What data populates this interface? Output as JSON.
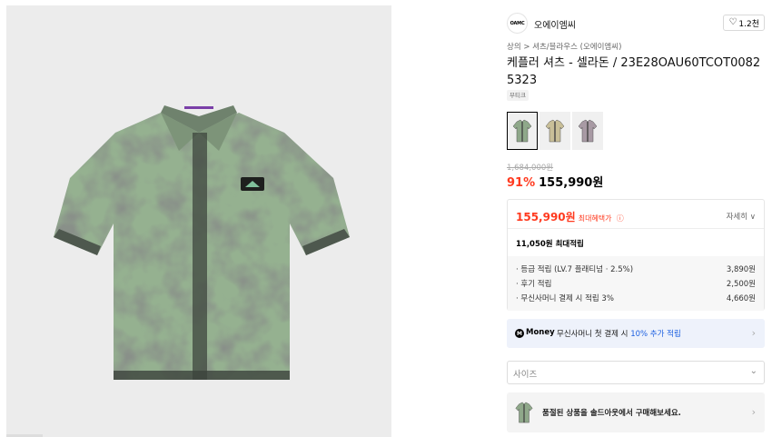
{
  "brand": {
    "logo_text": "OAMC",
    "name": "오에이엠씨",
    "likes": "1.2천"
  },
  "breadcrumb": "상의 > 셔츠/블라우스 (오에이엠씨)",
  "product": {
    "title": "케플러 셔츠 - 셀라돈 / 23E28OAU60TCOT00825323",
    "badge": "부티크",
    "original_price": "1,684,000원",
    "discount": "91%",
    "price": "155,990원"
  },
  "swatches": [
    {
      "color": "#8fa88a",
      "active": true
    },
    {
      "color": "#c9bf98",
      "active": false
    },
    {
      "color": "#a89aa4",
      "active": false
    }
  ],
  "benefits": {
    "price": "155,990원",
    "max_label": "최대혜택가",
    "info_icon": "ⓘ",
    "detail_link": "자세히 ∨",
    "points_max": "11,050원 최대적립",
    "points": [
      {
        "label": "· 등급 적립 (LV.7 플래티넘 · 2.5%)",
        "value": "3,890원"
      },
      {
        "label": "· 후기 적립",
        "value": "2,500원"
      },
      {
        "label": "· 무신사머니 결제 시 적립 3%",
        "value": "4,660원"
      }
    ]
  },
  "money_banner": {
    "icon_letter": "M",
    "brand": "Money",
    "text": "무신사머니 첫 결제 시",
    "highlight": "10% 추가 적립"
  },
  "size_select": {
    "placeholder": "사이즈"
  },
  "sold_out_banner": {
    "text": "품절된 상품을 솔드아웃에서 구매해보세요."
  },
  "icons": {
    "heart": "heart-icon",
    "chevron_right": "chevron-right-icon",
    "chevron_down": "chevron-down-icon"
  }
}
